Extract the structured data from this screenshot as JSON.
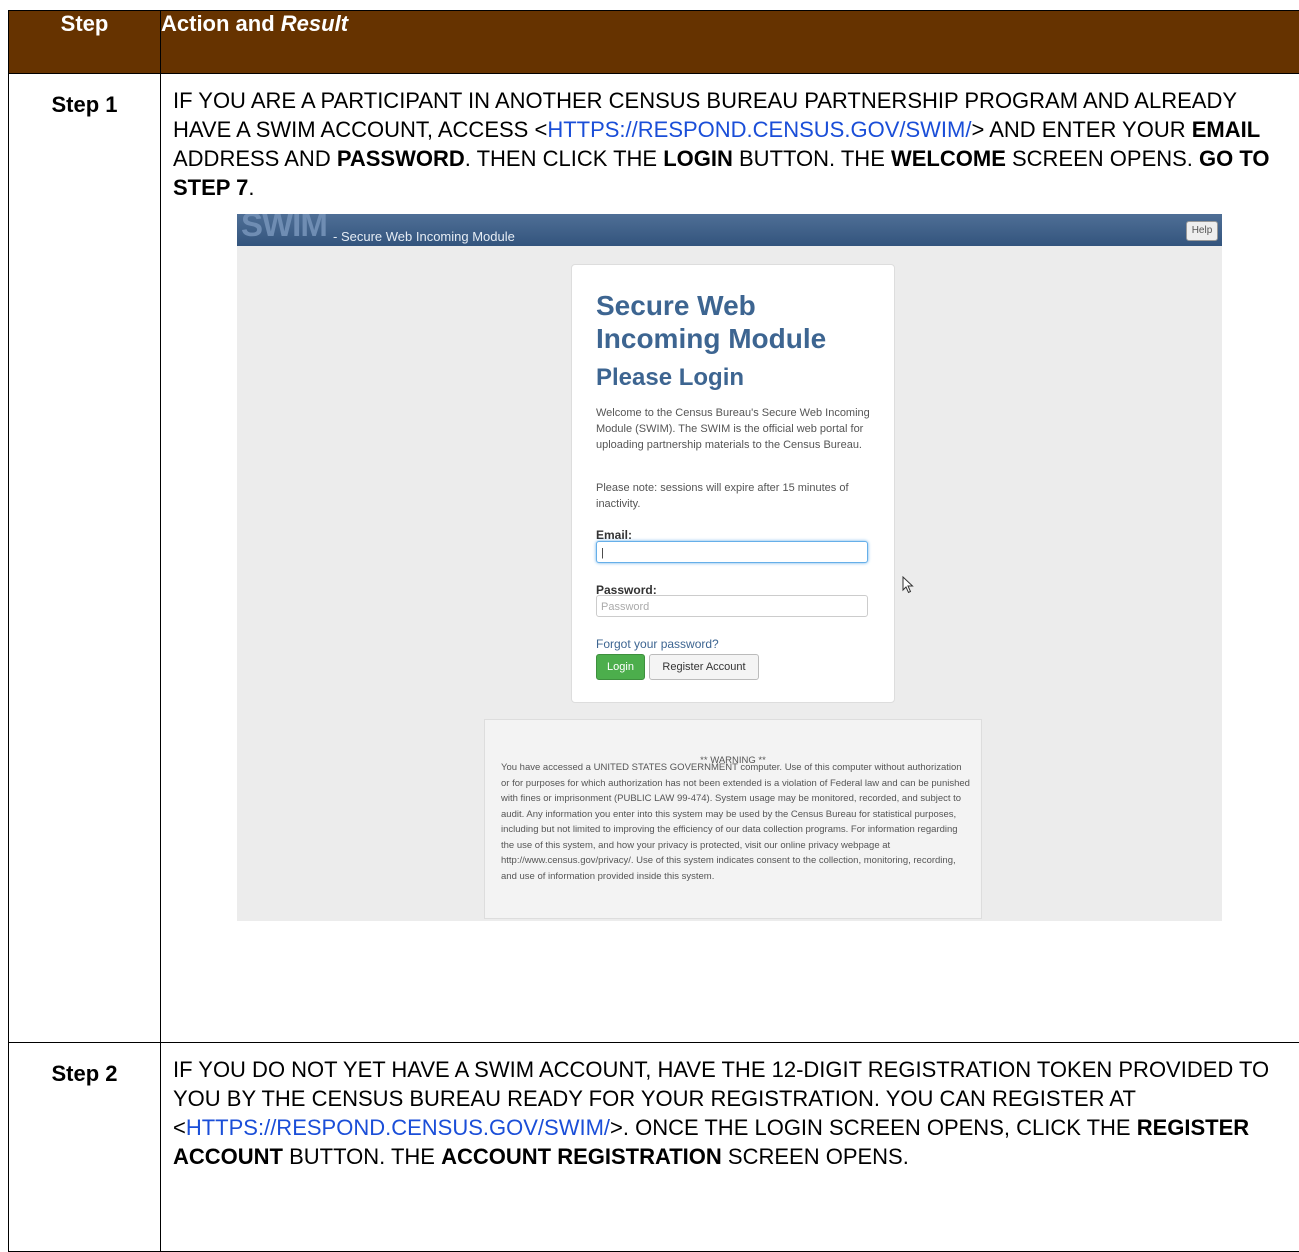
{
  "header": {
    "step": "Step",
    "action_prefix": "Action and ",
    "action_italic": "Result"
  },
  "rows": [
    {
      "step": "Step 1",
      "t1": "IF YOU ARE A PARTICIPANT IN ANOTHER CENSUS BUREAU PARTNERSHIP PROGRAM AND ALREADY HAVE A SWIM ACCOUNT, ACCESS <",
      "link": "HTTPS://RESPOND.CENSUS.GOV/SWIM/",
      "t2": "> AND ENTER YOUR ",
      "b1": "EMAIL",
      "t3": " ADDRESS AND ",
      "b2": "PASSWORD",
      "t4": ". THEN CLICK THE ",
      "b3": "LOGIN",
      "t5": " BUTTON. THE ",
      "b4": "WELCOME",
      "t6": " SCREEN OPENS. ",
      "b5": "GO TO STEP 7",
      "t7": "."
    },
    {
      "step": "Step 2",
      "t1": "IF YOU DO NOT YET HAVE A SWIM ACCOUNT, HAVE THE 12-DIGIT REGISTRATION TOKEN PROVIDED TO YOU BY THE CENSUS BUREAU READY FOR YOUR REGISTRATION. YOU CAN REGISTER AT <",
      "link": "HTTPS://RESPOND.CENSUS.GOV/SWIM/",
      "t2": ">. ONCE THE LOGIN SCREEN OPENS, CLICK THE ",
      "b1": "REGISTER ACCOUNT",
      "t3": " BUTTON. THE ",
      "b2": "ACCOUNT REGISTRATION",
      "t4": " SCREEN OPENS."
    }
  ],
  "swim": {
    "logo": "SWIM",
    "subtitle": "- Secure Web Incoming Module",
    "help": "Help",
    "title": "Secure Web Incoming Module",
    "subheading": "Please Login",
    "welcome": "Welcome to the Census Bureau's Secure Web Incoming Module (SWIM). The SWIM is the official web portal for uploading partnership materials to the Census Bureau.",
    "note": "Please note: sessions will expire after 15 minutes of inactivity.",
    "email_label": "Email:",
    "email_value": "|",
    "password_label": "Password:",
    "password_placeholder": "Password",
    "forgot": "Forgot your password?",
    "login_btn": "Login",
    "register_btn": "Register Account",
    "warning_title": "** WARNING **",
    "warning_text": "You have accessed a UNITED STATES GOVERNMENT computer. Use of this computer without authorization or for purposes for which authorization has not been extended is a violation of Federal law and can be punished with fines or imprisonment (PUBLIC LAW 99-474). System usage may be monitored, recorded, and subject to audit. Any information you enter into this system may be used by the Census Bureau for statistical purposes, including but not limited to improving the efficiency of our data collection programs. For information regarding the use of this system, and how your privacy is protected, visit our online privacy webpage at http://www.census.gov/privacy/. Use of this system indicates consent to the collection, monitoring, recording, and use of information provided inside this system."
  }
}
